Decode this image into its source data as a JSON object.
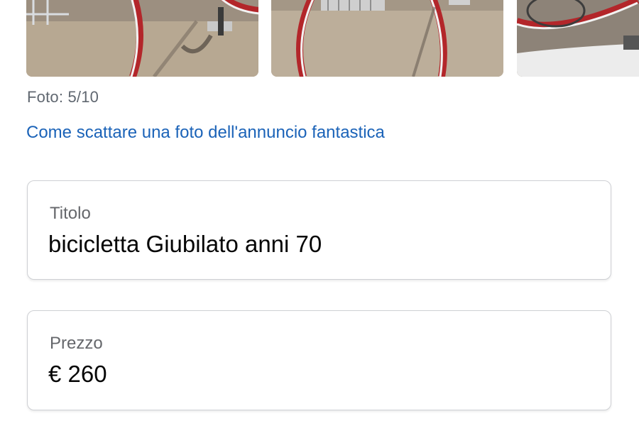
{
  "photos": {
    "count_label": "Foto: 5/10",
    "thumbnails": [
      {
        "name": "bicycle-photo-1"
      },
      {
        "name": "bicycle-photo-2"
      },
      {
        "name": "bicycle-photo-3"
      }
    ]
  },
  "tips_link": {
    "label": "Come scattare una foto dell'annuncio fantastica",
    "color": "#1b63b8"
  },
  "form": {
    "title": {
      "label": "Titolo",
      "value": "bicicletta Giubilato anni 70"
    },
    "price": {
      "label": "Prezzo",
      "value": "€ 260"
    }
  }
}
